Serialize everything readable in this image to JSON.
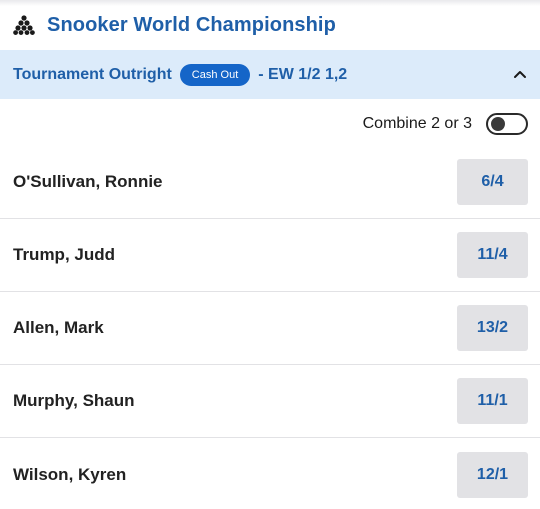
{
  "header": {
    "title": "Snooker World Championship",
    "icon": "snooker-balls-icon"
  },
  "market": {
    "name": "Tournament Outright",
    "cash_out_badge": "Cash Out",
    "each_way_terms": "- EW 1/2 1,2",
    "chevron_icon": "chevron-up-icon",
    "expanded": true
  },
  "combine": {
    "label": "Combine 2 or 3",
    "toggle_on": false
  },
  "runners": [
    {
      "name": "O'Sullivan, Ronnie",
      "odds": "6/4"
    },
    {
      "name": "Trump, Judd",
      "odds": "11/4"
    },
    {
      "name": "Allen, Mark",
      "odds": "13/2"
    },
    {
      "name": "Murphy, Shaun",
      "odds": "11/1"
    },
    {
      "name": "Wilson, Kyren",
      "odds": "12/1"
    }
  ],
  "colors": {
    "accent": "#1f5fa8",
    "header_bg": "#dcebfa",
    "badge_bg": "#1565c8",
    "odds_bg": "#e2e2e5"
  }
}
